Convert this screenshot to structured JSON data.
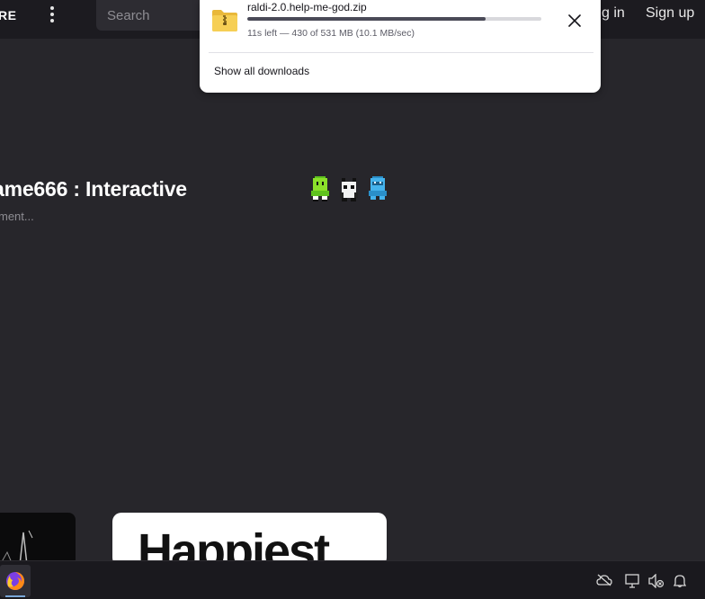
{
  "header": {
    "logo_text": "RE",
    "search_placeholder": "Search",
    "login_label": "g in",
    "signup_label": "Sign up"
  },
  "page": {
    "title": "ame666 : Interactive",
    "subtitle": "ment..."
  },
  "cards": [
    {
      "text": ""
    },
    {
      "text": "Happiest"
    }
  ],
  "downloads": {
    "filename": "raldi-2.0.help-me-god.zip",
    "progress_fraction": 0.81,
    "status": "11s left — 430 of 531 MB (10.1 MB/sec)",
    "show_all_label": "Show all downloads",
    "icon": "zip-archive-icon",
    "close_icon": "close-icon"
  },
  "taskbar": {
    "apps": [
      {
        "icon": "firefox-icon"
      }
    ],
    "tray": [
      "cloud-offline-icon",
      "display-icon",
      "volume-mute-icon",
      "notification-icon"
    ]
  },
  "colors": {
    "page_bg": "#27262b",
    "header_bg": "#1c1b20",
    "popup_bg": "#ffffff",
    "progress_fill": "#4a4a57"
  }
}
